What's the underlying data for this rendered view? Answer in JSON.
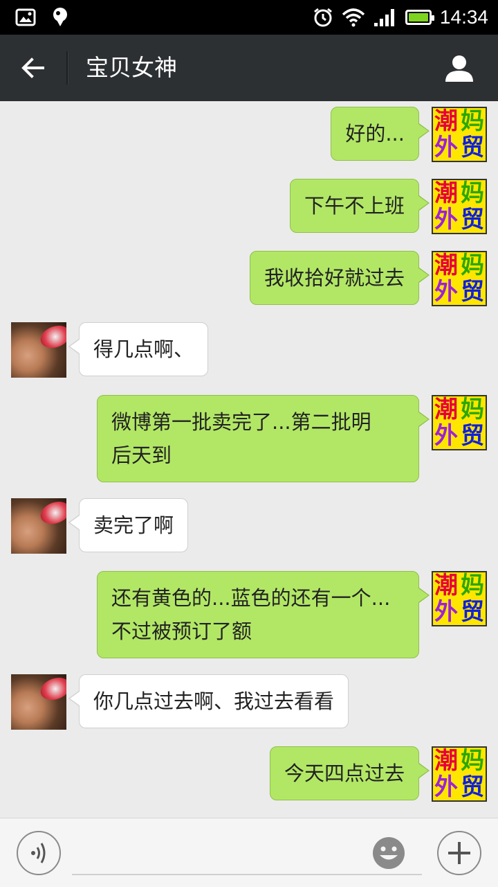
{
  "status_bar": {
    "time": "14:34",
    "battery_color": "#7ed321",
    "icons": [
      "image-notification-icon",
      "balloon-notification-icon",
      "alarm-icon",
      "wifi-icon",
      "signal-icon",
      "battery-icon"
    ]
  },
  "header": {
    "title": "宝贝女神",
    "back_icon": "back-arrow-icon",
    "profile_icon": "person-icon",
    "background": "#2d3033"
  },
  "self_avatar": {
    "chars": [
      "潮",
      "妈",
      "外",
      "贸"
    ],
    "background": "#ffe600"
  },
  "messages": [
    {
      "from": "me",
      "text": "好的..."
    },
    {
      "from": "me",
      "text": "下午不上班"
    },
    {
      "from": "me",
      "text": "我收拾好就过去"
    },
    {
      "from": "them",
      "text": "得几点啊、"
    },
    {
      "from": "me",
      "text": "微博第一批卖完了...第二批明\n后天到"
    },
    {
      "from": "them",
      "text": "卖完了啊"
    },
    {
      "from": "me",
      "text": "还有黄色的...蓝色的还有一个...\n不过被预订了额"
    },
    {
      "from": "them",
      "text": "你几点过去啊、我过去看看"
    },
    {
      "from": "me",
      "text": "今天四点过去"
    }
  ],
  "colors": {
    "my_bubble": "#b2e766",
    "their_bubble": "#ffffff",
    "chat_background": "#ebebeb"
  },
  "input_bar": {
    "placeholder": "",
    "voice_icon": "voice-icon",
    "emoji_icon": "emoji-icon",
    "more_icon": "plus-icon"
  }
}
